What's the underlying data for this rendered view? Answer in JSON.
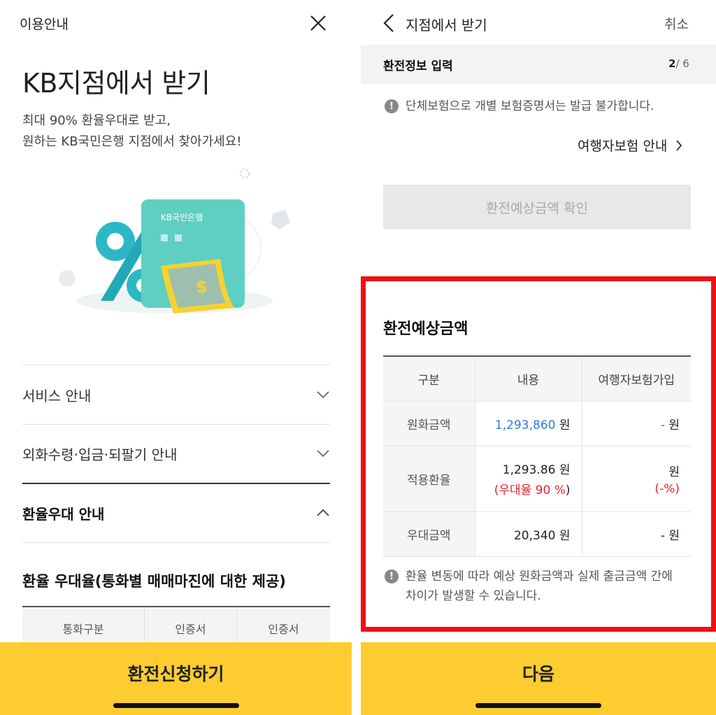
{
  "left": {
    "header_title": "이용안내",
    "heading": "KB지점에서 받기",
    "subtitle_line1": "최대 90% 환율우대로 받고,",
    "subtitle_line2": "원하는 KB국민은행 지점에서 찾아가세요!",
    "card_brand": "KB국민은행",
    "accordion": [
      {
        "label": "서비스 안내",
        "expanded": false
      },
      {
        "label": "외화수령·입금·되팔기 안내",
        "expanded": false
      },
      {
        "label": "환율우대 안내",
        "expanded": true
      }
    ],
    "rate_section_title": "환율 우대율(통화별 매매마진에 대한 제공)",
    "rate_table_headers": [
      "통화구분",
      "인증서",
      "인증서"
    ],
    "cta_button": "환전신청하기"
  },
  "right": {
    "header_title": "지점에서 받기",
    "cancel_label": "취소",
    "step_label": "환전정보 입력",
    "step_current": "2",
    "step_total": "/ 6",
    "notice_insurance": "단체보험으로 개별 보험증명서는 발급 불가합니다.",
    "insurance_link": "여행자보험 안내",
    "check_button": "환전예상금액 확인",
    "estimate_title": "환전예상금액",
    "table_headers": [
      "구분",
      "내용",
      "여행자보험가입"
    ],
    "rows": {
      "krw": {
        "label": "원화금액",
        "value": "1,293,860",
        "unit": "원",
        "ins_value": "-",
        "ins_unit": "원"
      },
      "rate": {
        "label": "적용환율",
        "value": "1,293.86",
        "unit": "원",
        "pref_open": "(",
        "pref_text": "우대율 90 %",
        "pref_close": ")",
        "ins_unit": "원",
        "ins_open": "(",
        "ins_pct": "-%",
        "ins_close": ")"
      },
      "discount": {
        "label": "우대금액",
        "value": "20,340",
        "unit": "원",
        "ins_value": "-",
        "ins_unit": "원"
      }
    },
    "notice_rate_line1": "환율 변동에 따라 예상 원화금액과 실제 출금금액 간에",
    "notice_rate_line2": "차이가 발생할 수 있습니다.",
    "next_button": "다음"
  },
  "colors": {
    "accent_yellow": "#fdcc30",
    "highlight_red": "#ee1111",
    "value_blue": "#2a7de1",
    "pref_red": "#e8232e"
  }
}
